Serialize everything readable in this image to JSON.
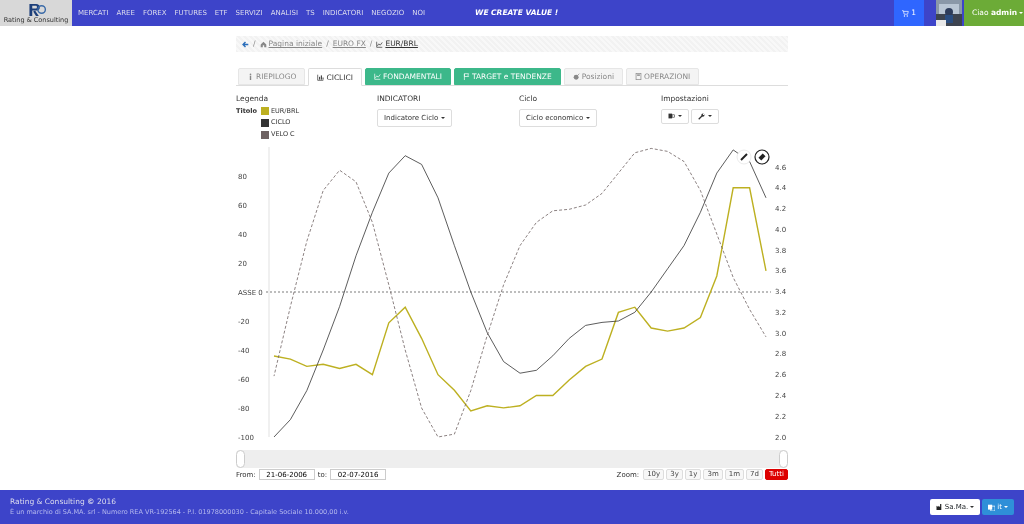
{
  "navbar": {
    "logo_text": "Rating & Consulting",
    "menu": [
      "MERCATI",
      "AREE",
      "FOREX",
      "FUTURES",
      "ETF",
      "SERVIZI",
      "ANALISI",
      "TS",
      "INDICATORI",
      "NEGOZIO",
      "NOI"
    ],
    "slogan": "WE CREATE VALUE !",
    "cart_count": "1",
    "user": "Ciao **admin**"
  },
  "breadcrumb": {
    "separator": "/",
    "items": [
      {
        "label": "Pagina iniziale"
      },
      {
        "label": "EURO FX"
      },
      {
        "label": "EUR/BRL"
      }
    ]
  },
  "tabs": [
    {
      "label": "RIEPILOGO",
      "selected": false,
      "highlighted": false
    },
    {
      "label": "CICLICI",
      "selected": true,
      "highlighted": false
    },
    {
      "label": "FONDAMENTALI",
      "selected": false,
      "highlighted": true
    },
    {
      "label": "TARGET e TENDENZE",
      "selected": false,
      "highlighted": true
    },
    {
      "label": "Posizioni",
      "selected": false,
      "highlighted": false
    },
    {
      "label": "OPERAZIONI",
      "selected": false,
      "highlighted": false
    }
  ],
  "legend": {
    "heading": "Legenda",
    "title_label": "Titolo"
  },
  "indicators": {
    "heading": "INDICATORI",
    "button": "Indicatore Ciclo"
  },
  "cycle": {
    "heading": "Ciclo",
    "button": "Ciclo economico"
  },
  "settings": {
    "heading": "Impostazioni"
  },
  "chart": {
    "chart_data": {
      "type": "line",
      "ylim": [
        -100,
        100
      ],
      "yticks": [
        80,
        60,
        40,
        20,
        {
          "value": 0,
          "label": "ASSE 0"
        },
        -20,
        -40,
        -60,
        -80,
        -100
      ],
      "y2lim": [
        2.0,
        4.6
      ],
      "y2ticks": [
        {
          "value": 4.6,
          "label": "4.6"
        },
        {
          "value": 4.4,
          "label": "4.4"
        },
        {
          "value": 4.2,
          "label": "4.2"
        },
        {
          "value": 4,
          "label": "4.0"
        },
        {
          "value": 3.8,
          "label": "3.8"
        },
        {
          "value": 3.6,
          "label": "3.6"
        },
        {
          "value": 3.4,
          "label": "3.4"
        },
        {
          "value": 3.2,
          "label": "3.2"
        },
        {
          "value": 3,
          "label": "3.0"
        },
        {
          "value": 2.8,
          "label": "2.8"
        },
        {
          "value": 2.6,
          "label": "2.6"
        },
        {
          "value": 2.4,
          "label": "2.4"
        },
        {
          "value": 2.2,
          "label": "2.2"
        },
        {
          "value": 2,
          "label": "2.0"
        }
      ],
      "series": [
        {
          "name": "EUR/BRL",
          "color": "#bdb021",
          "axis": "y2",
          "line_style": "solid",
          "values": [
            2.78,
            2.75,
            2.68,
            2.7,
            2.66,
            2.7,
            2.6,
            3.1,
            3.25,
            2.95,
            2.6,
            2.45,
            2.25,
            2.3,
            2.28,
            2.3,
            2.4,
            2.4,
            2.55,
            2.68,
            2.75,
            3.2,
            3.25,
            3.05,
            3.02,
            3.05,
            3.15,
            3.55,
            4.4,
            4.4,
            3.6
          ]
        },
        {
          "name": "CICLO",
          "color": "#333333",
          "line_style": "solid",
          "values": [
            -100,
            -88,
            -68,
            -40,
            -10,
            25,
            55,
            82,
            94,
            88,
            65,
            32,
            0,
            -28,
            -48,
            -56,
            -54,
            -44,
            -32,
            -23,
            -21,
            -20,
            -14,
            0,
            16,
            32,
            55,
            82,
            98,
            90,
            65
          ]
        },
        {
          "name": "VELO C",
          "color": "#6e6262",
          "line_style": "dashed",
          "values": [
            -58,
            -10,
            35,
            70,
            84,
            76,
            48,
            5,
            -40,
            -80,
            -100,
            -98,
            -68,
            -30,
            5,
            32,
            48,
            56,
            57,
            60,
            68,
            82,
            96,
            99,
            97,
            90,
            70,
            40,
            10,
            -12,
            -31
          ]
        }
      ]
    }
  },
  "range": {
    "from_label": "From:",
    "from": "21-06-2006",
    "to_label": "to:",
    "to": "02-07-2016",
    "zoom_label": "Zoom:",
    "zoom": [
      {
        "label": "10y",
        "selected": false
      },
      {
        "label": "3y",
        "selected": false
      },
      {
        "label": "1y",
        "selected": false
      },
      {
        "label": "3m",
        "selected": false
      },
      {
        "label": "1m",
        "selected": false
      },
      {
        "label": "7d",
        "selected": false
      },
      {
        "label": "Tutti",
        "selected": true
      }
    ]
  },
  "footer": {
    "copyright": "Rating & Consulting **©** 2016",
    "legal": "È un marchio di SA.MA. srl - Numero REA VR-192564 - P.I. 01978000030 - Capitale Sociale 10.000,00 i.v.",
    "company_button": "Sa.Ma.",
    "language_button": "it"
  }
}
